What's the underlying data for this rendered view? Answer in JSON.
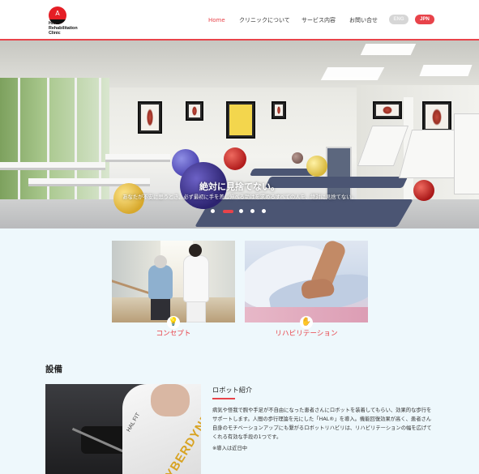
{
  "header": {
    "logo_mark": "A",
    "logo_lines": [
      "HMW",
      "Rehabilitation",
      "Clinic"
    ],
    "nav": [
      {
        "label": "Home",
        "active": true
      },
      {
        "label": "クリニックについて",
        "active": false
      },
      {
        "label": "サービス内容",
        "active": false
      },
      {
        "label": "お問い合せ",
        "active": false
      }
    ],
    "lang": {
      "eng": "ENG",
      "jpn": "JPN",
      "selected": "JPN"
    }
  },
  "hero": {
    "title": "絶対に見捨てない。",
    "subtitle": "あなたが不安に思うとき、必ず最初に手を差し伸べる助けを求めるすべての人を、絶対に見捨てない。",
    "slide_count": 5,
    "active_slide": 2
  },
  "cards": [
    {
      "label": "コンセプト",
      "icon": "lightbulb-icon"
    },
    {
      "label": "リハビリテーション",
      "icon": "hand-icon"
    }
  ],
  "equipment": {
    "section_title": "設備",
    "image_brand_text": "CYBERDYNE",
    "image_model_text": "HAL FIT",
    "robot_title": "ロボット紹介",
    "robot_body": "病気や怪我で腕や手足が不自由になった患者さんにロボットを装着してもらい、効果的な歩行をサポートします。人間の歩行理論を元にした「HAL®」を導入。機能回復効果が高く、患者さん自身のモチベーションアップにも繋がるロボットリハビリは、リハビリテーションの幅を広げてくれる有効な手段の1つです。",
    "robot_note": "※導入は近日中"
  },
  "colors": {
    "accent": "#e8434a",
    "page_bg": "#eef8fc",
    "icon": "#f2a23b"
  }
}
